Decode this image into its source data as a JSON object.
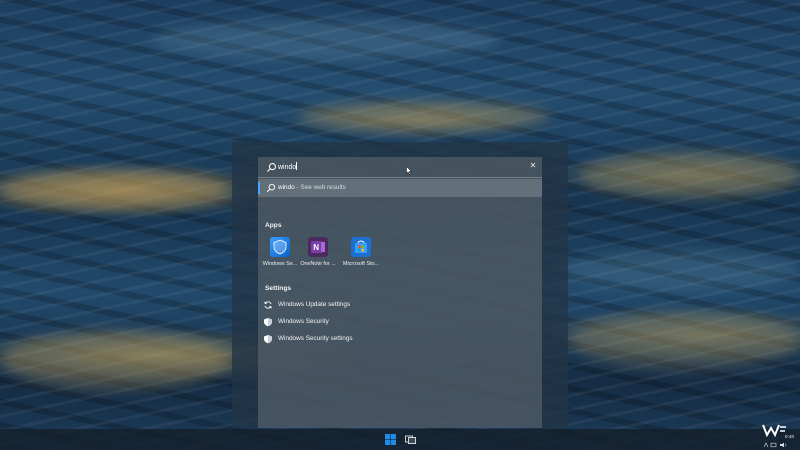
{
  "search": {
    "query": "windo",
    "clear_icon": "close-icon"
  },
  "best_match": {
    "query": "windo",
    "suffix": " - See web results"
  },
  "apps": {
    "heading": "Apps",
    "items": [
      {
        "label": "Windows Se...",
        "icon": "windows-security-icon",
        "color": "#1f7fe0"
      },
      {
        "label": "OneNote for ...",
        "icon": "onenote-icon",
        "color": "#7b3fa8"
      },
      {
        "label": "Microsoft Sto...",
        "icon": "microsoft-store-icon",
        "color": "#2c8fe8"
      }
    ]
  },
  "settings": {
    "heading": "Settings",
    "items": [
      {
        "label": "Windows Update settings",
        "icon": "sync-icon"
      },
      {
        "label": "Windows Security",
        "icon": "shield-icon"
      },
      {
        "label": "Windows Security settings",
        "icon": "shield-icon"
      }
    ]
  },
  "taskbar": {
    "start_icon": "windows-logo-icon",
    "taskview_icon": "task-view-icon",
    "clock": "9:48"
  },
  "colors": {
    "accent": "#4aa3ff",
    "windows_blue": "#1f8ce8"
  }
}
